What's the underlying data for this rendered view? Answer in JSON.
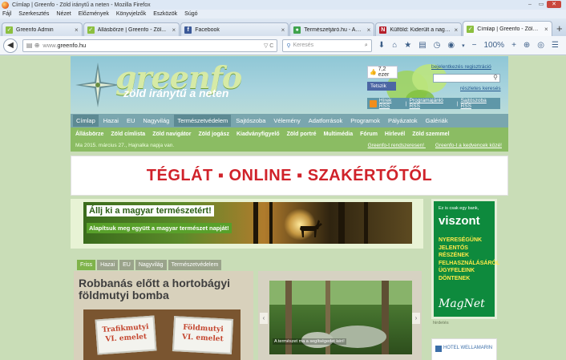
{
  "window": {
    "title": "Címlap | Greenfo - Zöld iránytű a neten - Mozilla Firefox",
    "controls": [
      "–",
      "▭",
      "✕"
    ]
  },
  "menu": [
    "Fájl",
    "Szerkesztés",
    "Nézet",
    "Előzmények",
    "Könyvjelzők",
    "Eszközök",
    "Súgó"
  ],
  "tabs": [
    {
      "title": "Greenfo Admin",
      "icon_color": "#8cbf3f",
      "icon_char": "✓",
      "active": false
    },
    {
      "title": "Állásbörze | Greenfo - Zöl...",
      "icon_color": "#8cbf3f",
      "icon_char": "✓",
      "active": false
    },
    {
      "title": "Facebook",
      "icon_color": "#3b5998",
      "icon_char": "f",
      "active": false
    },
    {
      "title": "Természetjáró.hu - Az erd...",
      "icon_color": "#3fa34d",
      "icon_char": "●",
      "active": false
    },
    {
      "title": "Külföld: Kiderült a nagy is...",
      "icon_color": "#b51f2b",
      "icon_char": "N",
      "active": false
    },
    {
      "title": "Címlap | Greenfo - Zöld ir...",
      "icon_color": "#8cbf3f",
      "icon_char": "✓",
      "active": true
    }
  ],
  "nav": {
    "url_prefix": "www.",
    "url_domain": "greenfo.hu",
    "url_tail": "▽ C",
    "search_placeholder": "Keresés",
    "zoom": "100%"
  },
  "header": {
    "logo_word": "greenfo",
    "logo_sub": "zöld iránytű a neten",
    "like_count": "7,2 ezer",
    "like_button": "Tetszik",
    "top_links": "bejelentkezés  regisztráció",
    "advanced_search": "részletes keresés",
    "rss_links": [
      "Hírek RSS",
      "Programajánló RSS",
      "Sajtószoba RSS"
    ]
  },
  "main_nav": [
    {
      "label": "Címlap",
      "active": true
    },
    {
      "label": "Hazai",
      "active": false
    },
    {
      "label": "EU",
      "active": false
    },
    {
      "label": "Nagyvilág",
      "active": false
    },
    {
      "label": "Természetvédelem",
      "active": true
    },
    {
      "label": "Sajtószoba",
      "active": false
    },
    {
      "label": "Vélemény",
      "active": false
    },
    {
      "label": "Adatforrások",
      "active": false
    },
    {
      "label": "Programok",
      "active": false
    },
    {
      "label": "Pályázatok",
      "active": false
    },
    {
      "label": "Galériák",
      "active": false
    }
  ],
  "sub_nav": {
    "links": [
      "Állásbörze",
      "Zöld címlista",
      "Zöld navigátor",
      "Zöld jogász",
      "Kiadványfigyelő",
      "Zöld portré",
      "Multimédia",
      "Fórum",
      "Hírlevél",
      "Zöld szemmel"
    ],
    "date": "Ma 2015. március 27., Hajnalka napja van.",
    "right_links": [
      "Greenfo-t rendszeresen!",
      "Greenfo-t a kedvencek közé!"
    ]
  },
  "banner": {
    "text": "TÉGLÁT ▪ ONLINE ▪ SZAKÉRTŐTŐL",
    "color": "#d0222a"
  },
  "ad": {
    "line1": "Állj ki a magyar természetért!",
    "line2": "Alapítsuk meg együtt a magyar természet napját!"
  },
  "side_ad": {
    "small": "Ez is csak egy bank,",
    "big": "viszont",
    "body": "NYERESÉGÜNK JELENTŐS RÉSZÉNEK FELHASZNÁLÁSÁRÓL ÜGYFELEINK DÖNTENEK",
    "logo": "MagNet",
    "label": "hirdetés",
    "hotel": "HOTEL WELLAMARIN"
  },
  "category_tabs": [
    {
      "label": "Friss",
      "active": true
    },
    {
      "label": "Hazai",
      "active": false
    },
    {
      "label": "EU",
      "active": false
    },
    {
      "label": "Nagyvilág",
      "active": false
    },
    {
      "label": "Természetvédelem",
      "active": false
    }
  ],
  "feature": {
    "title": "Robbanás előtt a hortobágyi földmutyi bomba",
    "sign1_line1": "Trafikmutyi",
    "sign1_line2": "VI. emelet",
    "sign2_line1": "Földmutyi",
    "sign2_line2": "VI. emelet"
  },
  "slider": {
    "caption": "A természet ma a segítségedet kéri!",
    "prev": "‹",
    "next": "›"
  }
}
